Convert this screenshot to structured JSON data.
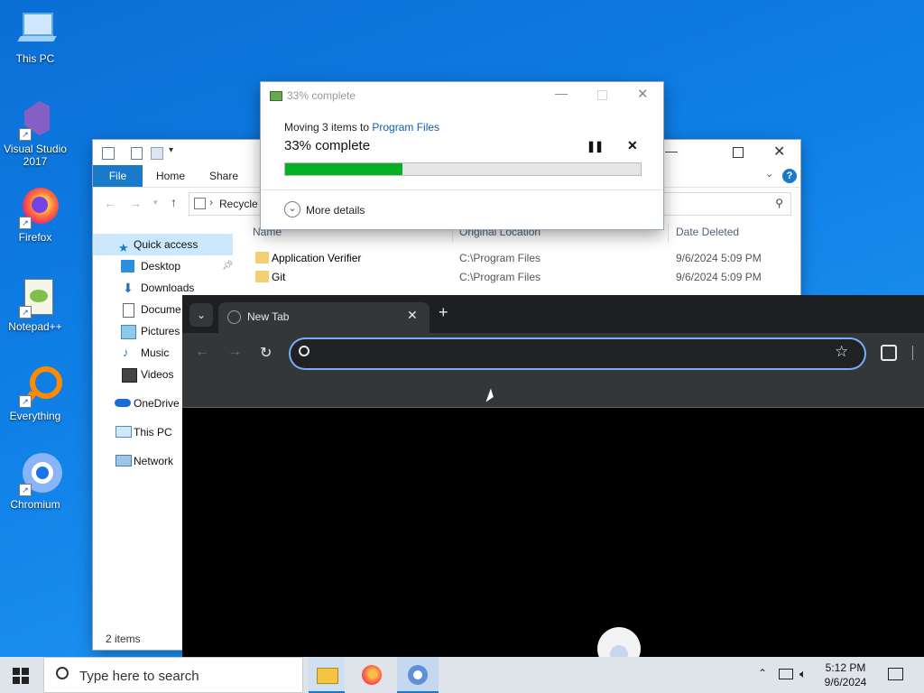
{
  "desktop": {
    "icons": [
      {
        "label": "This PC"
      },
      {
        "label": "Visual Studio 2017"
      },
      {
        "label": "Firefox"
      },
      {
        "label": "Notepad++"
      },
      {
        "label": "Everything"
      },
      {
        "label": "Chromium"
      }
    ]
  },
  "explorer": {
    "ribbon": {
      "file": "File",
      "home": "Home",
      "share": "Share"
    },
    "address": "Recycle",
    "nav": [
      "Quick access",
      "Desktop",
      "Downloads",
      "Docume",
      "Pictures",
      "Music",
      "Videos",
      "OneDrive",
      "This PC",
      "Network"
    ],
    "columns": {
      "name": "Name",
      "location": "Original Location",
      "date": "Date Deleted"
    },
    "rows": [
      {
        "name": "Application Verifier",
        "location": "C:\\Program Files",
        "date": "9/6/2024 5:09 PM"
      },
      {
        "name": "Git",
        "location": "C:\\Program Files",
        "date": "9/6/2024 5:09 PM"
      }
    ],
    "status": "2 items"
  },
  "copy_dialog": {
    "title": "33% complete",
    "moving_prefix": "Moving 3 items to ",
    "destination": "Program Files",
    "progress_text": "33% complete",
    "progress": 0.33,
    "more_details": "More details"
  },
  "chromium": {
    "tab_title": "New Tab"
  },
  "taskbar": {
    "search_placeholder": "Type here to search",
    "time": "5:12 PM",
    "date": "9/6/2024"
  },
  "colors": {
    "accent": "#1979ca",
    "progress": "#06b025",
    "chrome_focus": "#7cacf8"
  }
}
